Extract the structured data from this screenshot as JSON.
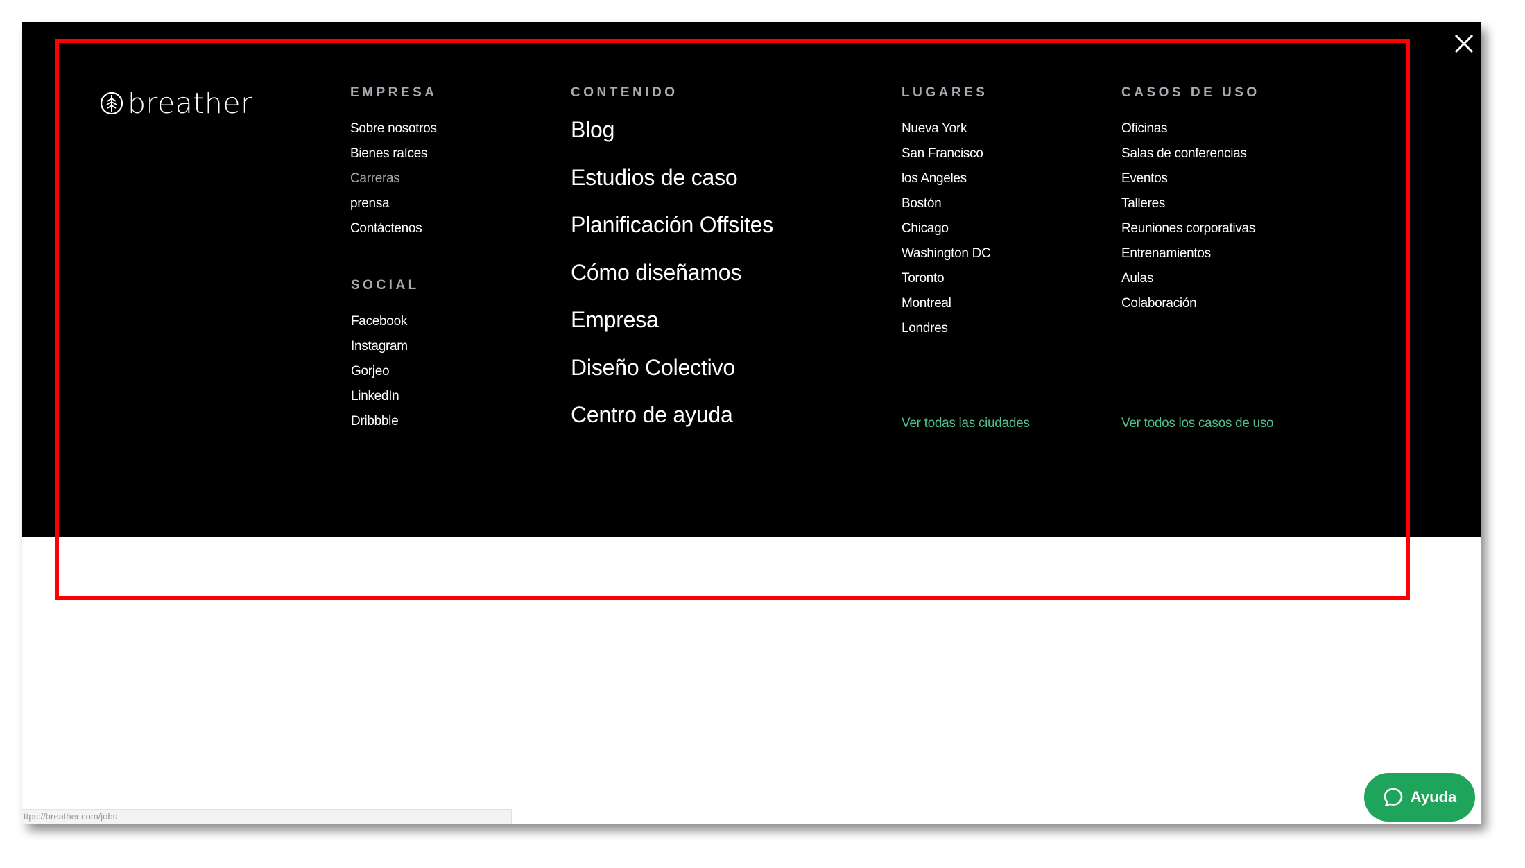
{
  "logo": {
    "text": "breather"
  },
  "empresa": {
    "heading": "EMPRESA",
    "items": [
      "Sobre nosotros",
      "Bienes raíces",
      "Carreras",
      "prensa",
      "Contáctenos"
    ]
  },
  "social": {
    "heading": "SOCIAL",
    "items": [
      "Facebook",
      "Instagram",
      "Gorjeo",
      "LinkedIn",
      "Dribbble"
    ]
  },
  "contenido": {
    "heading": "CONTENIDO",
    "items": [
      "Blog",
      "Estudios de caso",
      "Planificación Offsites",
      "Cómo diseñamos",
      "Empresa",
      "Diseño Colectivo",
      "Centro de ayuda"
    ]
  },
  "lugares": {
    "heading": "LUGARES",
    "items": [
      "Nueva York",
      "San Francisco",
      "los Angeles",
      "Bostón",
      "Chicago",
      "Washington DC",
      "Toronto",
      "Montreal",
      "Londres"
    ],
    "see_all": "Ver todas las ciudades"
  },
  "casos": {
    "heading": "CASOS DE USO",
    "items": [
      "Oficinas",
      "Salas de conferencias",
      "Eventos",
      "Talleres",
      "Reuniones corporativas",
      "Entrenamientos",
      "Aulas",
      "Colaboración"
    ],
    "see_all": "Ver todos los casos de uso"
  },
  "help_button": {
    "label": "Ayuda"
  },
  "status_bar": {
    "url": "ttps://breather.com/jobs"
  },
  "colors": {
    "menu_bg": "#000000",
    "accent_green": "#4fc08d",
    "help_green": "#1fa45c",
    "highlight": "#ff0000"
  }
}
